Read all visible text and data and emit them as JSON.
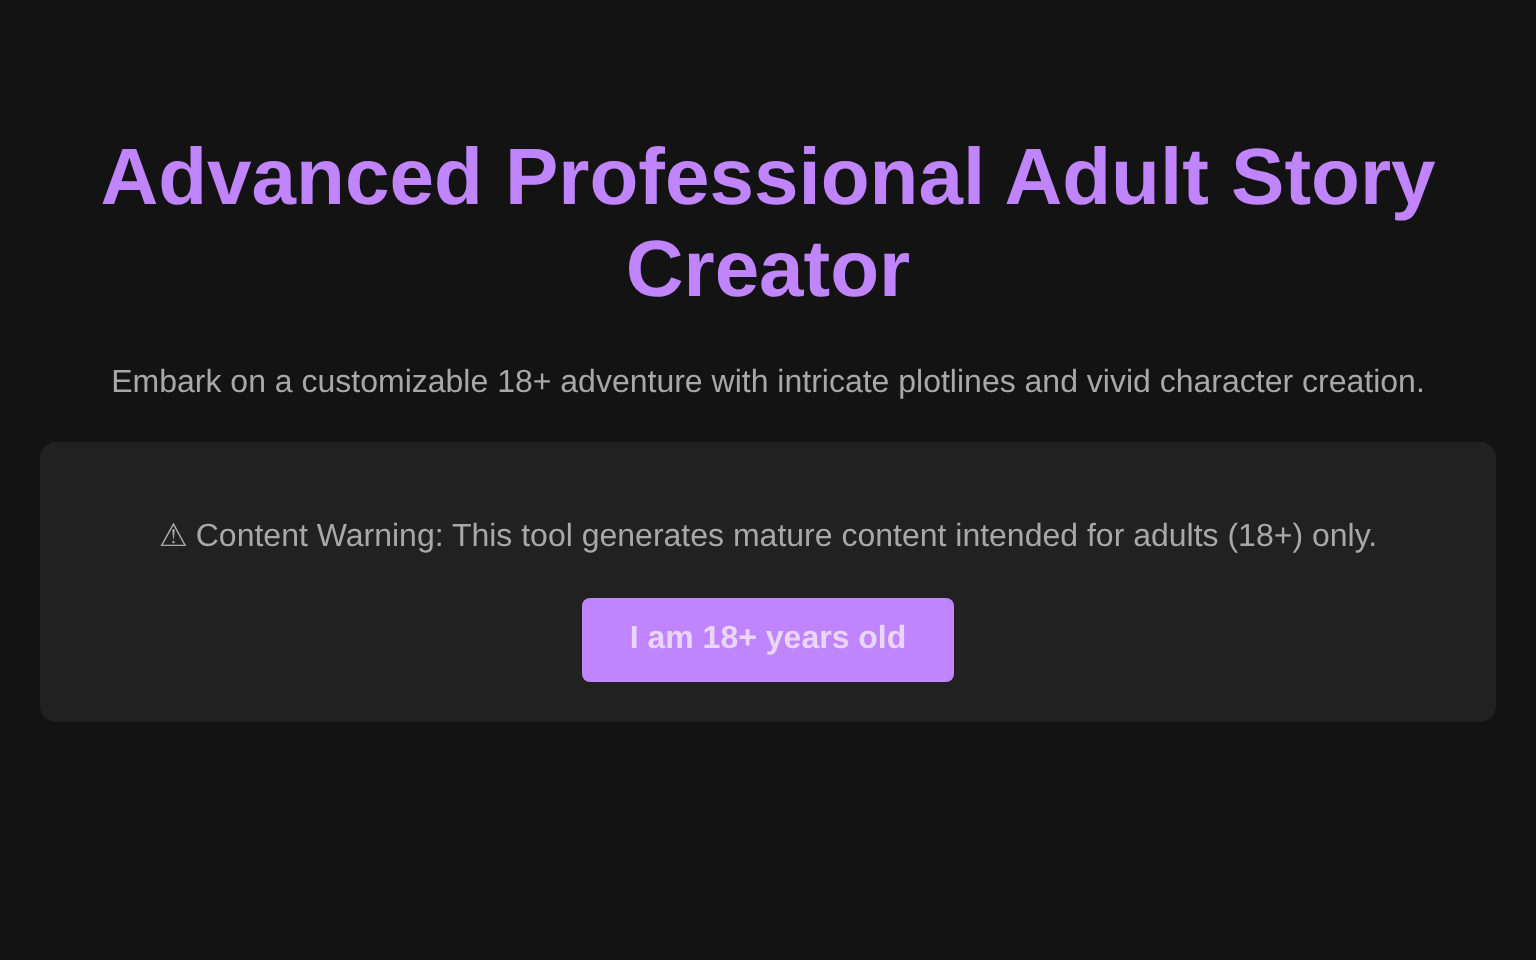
{
  "title": "Advanced Professional Adult Story Creator",
  "subtitle": "Embark on a customizable 18+ adventure with intricate plotlines and vivid character creation.",
  "age_gate": {
    "warning": "⚠ Content Warning: This tool generates mature content intended for adults (18+) only.",
    "button": "I am 18+ years old"
  }
}
